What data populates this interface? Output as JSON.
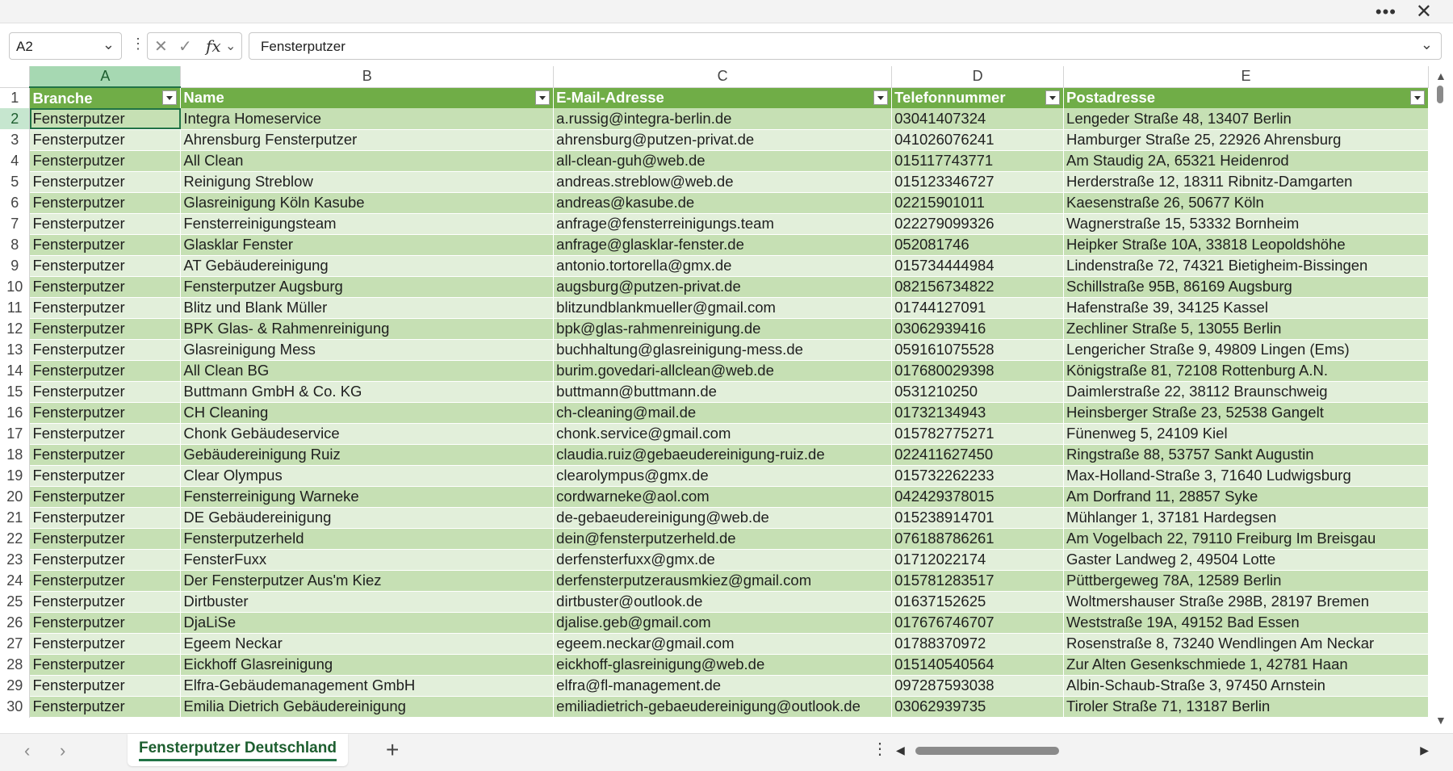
{
  "toolbar": {
    "more_icon": "more-horizontal-icon",
    "close_icon": "close-icon"
  },
  "formula_bar": {
    "name_box": "A2",
    "content": "Fensterputzer"
  },
  "columns": [
    "A",
    "B",
    "C",
    "D",
    "E"
  ],
  "headers": [
    "Branche",
    "Name",
    "E-Mail-Adresse",
    "Telefonnummer",
    "Postadresse"
  ],
  "rows": [
    {
      "n": "2",
      "a": "Fensterputzer",
      "b": "Integra Homeservice",
      "c": "a.russig@integra-berlin.de",
      "d": "03041407324",
      "e": "Lengeder Straße 48, 13407 Berlin"
    },
    {
      "n": "3",
      "a": "Fensterputzer",
      "b": "Ahrensburg Fensterputzer",
      "c": "ahrensburg@putzen-privat.de",
      "d": "041026076241",
      "e": "Hamburger Straße 25, 22926 Ahrensburg"
    },
    {
      "n": "4",
      "a": "Fensterputzer",
      "b": "All Clean",
      "c": "all-clean-guh@web.de",
      "d": "015117743771",
      "e": "Am Staudig 2A, 65321 Heidenrod"
    },
    {
      "n": "5",
      "a": "Fensterputzer",
      "b": "Reinigung Streblow",
      "c": "andreas.streblow@web.de",
      "d": "015123346727",
      "e": "Herderstraße 12, 18311 Ribnitz-Damgarten"
    },
    {
      "n": "6",
      "a": "Fensterputzer",
      "b": "Glasreinigung Köln Kasube",
      "c": "andreas@kasube.de",
      "d": "02215901011",
      "e": "Kaesenstraße 26, 50677 Köln"
    },
    {
      "n": "7",
      "a": "Fensterputzer",
      "b": "Fensterreinigungsteam",
      "c": "anfrage@fensterreinigungs.team",
      "d": "022279099326",
      "e": "Wagnerstraße 15, 53332 Bornheim"
    },
    {
      "n": "8",
      "a": "Fensterputzer",
      "b": "Glasklar Fenster",
      "c": "anfrage@glasklar-fenster.de",
      "d": "052081746",
      "e": "Heipker Straße 10A, 33818 Leopoldshöhe"
    },
    {
      "n": "9",
      "a": "Fensterputzer",
      "b": "AT Gebäudereinigung",
      "c": "antonio.tortorella@gmx.de",
      "d": "015734444984",
      "e": "Lindenstraße 72, 74321 Bietigheim-Bissingen"
    },
    {
      "n": "10",
      "a": "Fensterputzer",
      "b": "Fensterputzer Augsburg",
      "c": "augsburg@putzen-privat.de",
      "d": "082156734822",
      "e": "Schillstraße 95B, 86169 Augsburg"
    },
    {
      "n": "11",
      "a": "Fensterputzer",
      "b": "Blitz und Blank Müller",
      "c": "blitzundblankmueller@gmail.com",
      "d": "01744127091",
      "e": "Hafenstraße 39, 34125 Kassel"
    },
    {
      "n": "12",
      "a": "Fensterputzer",
      "b": "BPK Glas- & Rahmenreinigung",
      "c": "bpk@glas-rahmenreinigung.de",
      "d": "03062939416",
      "e": "Zechliner Straße 5, 13055 Berlin"
    },
    {
      "n": "13",
      "a": "Fensterputzer",
      "b": "Glasreinigung Mess",
      "c": "buchhaltung@glasreinigung-mess.de",
      "d": "059161075528",
      "e": "Lengericher Straße 9, 49809 Lingen (Ems)"
    },
    {
      "n": "14",
      "a": "Fensterputzer",
      "b": "All Clean BG",
      "c": "burim.govedari-allclean@web.de",
      "d": "017680029398",
      "e": "Königstraße 81, 72108 Rottenburg A.N."
    },
    {
      "n": "15",
      "a": "Fensterputzer",
      "b": "Buttmann GmbH & Co. KG",
      "c": "buttmann@buttmann.de",
      "d": "0531210250",
      "e": "Daimlerstraße 22, 38112 Braunschweig"
    },
    {
      "n": "16",
      "a": "Fensterputzer",
      "b": "CH Cleaning",
      "c": "ch-cleaning@mail.de",
      "d": "01732134943",
      "e": "Heinsberger Straße 23, 52538 Gangelt"
    },
    {
      "n": "17",
      "a": "Fensterputzer",
      "b": "Chonk Gebäudeservice",
      "c": "chonk.service@gmail.com",
      "d": "015782775271",
      "e": "Fünenweg 5, 24109 Kiel"
    },
    {
      "n": "18",
      "a": "Fensterputzer",
      "b": "Gebäudereinigung Ruiz",
      "c": "claudia.ruiz@gebaeudereinigung-ruiz.de",
      "d": "022411627450",
      "e": "Ringstraße 88, 53757 Sankt Augustin"
    },
    {
      "n": "19",
      "a": "Fensterputzer",
      "b": "Clear Olympus",
      "c": "clearolympus@gmx.de",
      "d": "015732262233",
      "e": "Max-Holland-Straße 3, 71640 Ludwigsburg"
    },
    {
      "n": "20",
      "a": "Fensterputzer",
      "b": "Fensterreinigung Warneke",
      "c": "cordwarneke@aol.com",
      "d": "042429378015",
      "e": "Am Dorfrand 11, 28857 Syke"
    },
    {
      "n": "21",
      "a": "Fensterputzer",
      "b": "DE Gebäudereinigung",
      "c": "de-gebaeudereinigung@web.de",
      "d": "015238914701",
      "e": "Mühlanger 1, 37181 Hardegsen"
    },
    {
      "n": "22",
      "a": "Fensterputzer",
      "b": "Fensterputzerheld",
      "c": "dein@fensterputzerheld.de",
      "d": "076188786261",
      "e": "Am Vogelbach 22, 79110 Freiburg Im Breisgau"
    },
    {
      "n": "23",
      "a": "Fensterputzer",
      "b": "FensterFuxx",
      "c": "derfensterfuxx@gmx.de",
      "d": "01712022174",
      "e": "Gaster Landweg 2, 49504 Lotte"
    },
    {
      "n": "24",
      "a": "Fensterputzer",
      "b": "Der Fensterputzer Aus'm Kiez",
      "c": "derfensterputzerausmkiez@gmail.com",
      "d": "015781283517",
      "e": "Püttbergeweg 78A, 12589 Berlin"
    },
    {
      "n": "25",
      "a": "Fensterputzer",
      "b": "Dirtbuster",
      "c": "dirtbuster@outlook.de",
      "d": "01637152625",
      "e": "Woltmershauser Straße 298B, 28197 Bremen"
    },
    {
      "n": "26",
      "a": "Fensterputzer",
      "b": "DjaLiSe",
      "c": "djalise.geb@gmail.com",
      "d": "017676746707",
      "e": "Weststraße 19A, 49152 Bad Essen"
    },
    {
      "n": "27",
      "a": "Fensterputzer",
      "b": "Egeem Neckar",
      "c": "egeem.neckar@gmail.com",
      "d": "01788370972",
      "e": "Rosenstraße 8, 73240 Wendlingen Am Neckar"
    },
    {
      "n": "28",
      "a": "Fensterputzer",
      "b": "Eickhoff Glasreinigung",
      "c": "eickhoff-glasreinigung@web.de",
      "d": "015140540564",
      "e": "Zur Alten Gesenkschmiede 1, 42781 Haan"
    },
    {
      "n": "29",
      "a": "Fensterputzer",
      "b": "Elfra-Gebäudemanagement GmbH",
      "c": "elfra@fl-management.de",
      "d": "097287593038",
      "e": "Albin-Schaub-Straße 3, 97450 Arnstein"
    },
    {
      "n": "30",
      "a": "Fensterputzer",
      "b": "Emilia Dietrich Gebäudereinigung",
      "c": "emiliadietrich-gebaeudereinigung@outlook.de",
      "d": "03062939735",
      "e": "Tiroler Straße 71, 13187 Berlin"
    }
  ],
  "sheet_tabs": [
    "Fensterputzer Deutschland"
  ],
  "colors": {
    "header_green": "#70ad47",
    "band_dark": "#c6e0b4",
    "band_light": "#e2efda",
    "accent": "#217346"
  }
}
